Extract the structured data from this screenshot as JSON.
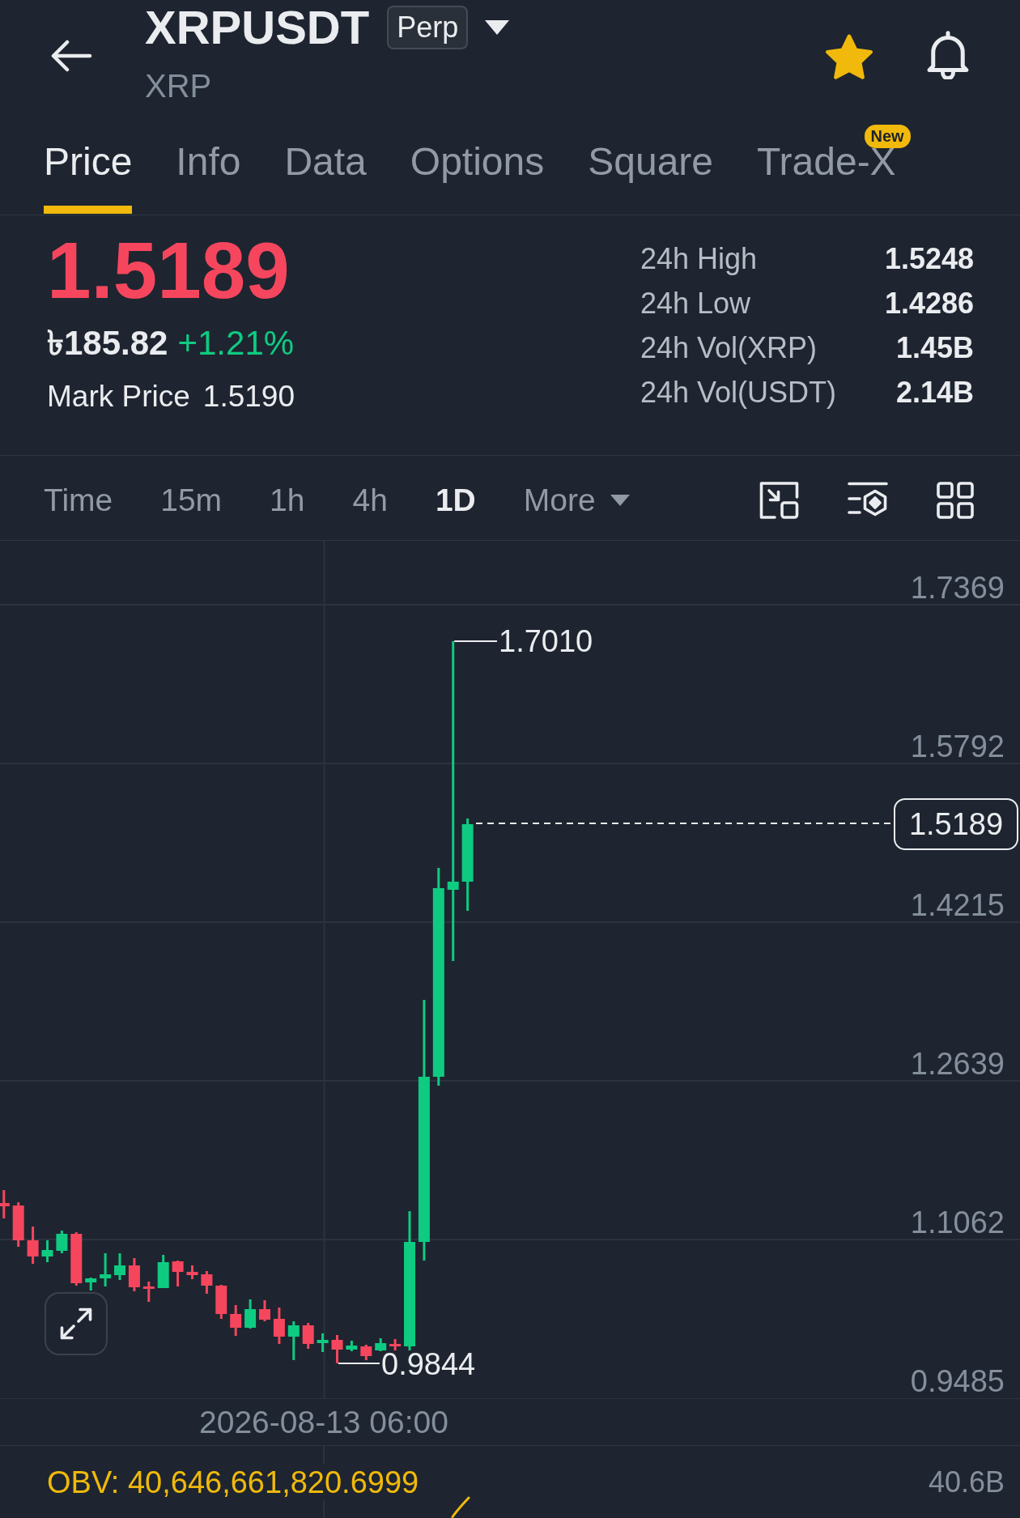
{
  "header": {
    "symbol": "XRPUSDT",
    "contract_badge": "Perp",
    "base_asset": "XRP",
    "favorited": true
  },
  "tabs": [
    {
      "label": "Price",
      "selected": true
    },
    {
      "label": "Info",
      "selected": false
    },
    {
      "label": "Data",
      "selected": false
    },
    {
      "label": "Options",
      "selected": false
    },
    {
      "label": "Square",
      "selected": false
    },
    {
      "label": "Trade-X",
      "selected": false,
      "badge": "New"
    }
  ],
  "ticker": {
    "last_price": "1.5189",
    "last_price_falling": true,
    "fiat_price": "৳185.82",
    "change": "+1.21%",
    "change_positive": true,
    "mark_price_label": "Mark Price",
    "mark_price": "1.5190"
  },
  "stats": [
    {
      "label": "24h High",
      "value": "1.5248"
    },
    {
      "label": "24h Low",
      "value": "1.4286"
    },
    {
      "label": "24h Vol(XRP)",
      "value": "1.45B"
    },
    {
      "label": "24h Vol(USDT)",
      "value": "2.14B"
    }
  ],
  "intervals": [
    {
      "label": "Time",
      "kind": "option",
      "selected": false
    },
    {
      "label": "15m",
      "kind": "option",
      "selected": false
    },
    {
      "label": "1h",
      "kind": "option",
      "selected": false
    },
    {
      "label": "4h",
      "kind": "option",
      "selected": false
    },
    {
      "label": "1D",
      "kind": "option",
      "selected": true
    },
    {
      "label": "More",
      "kind": "menu",
      "selected": false
    }
  ],
  "chart": {
    "price_axis_labels": [
      "1.7369",
      "1.5792",
      "1.4215",
      "1.2639",
      "1.1062",
      "0.9485"
    ],
    "high_label": "1.7010",
    "low_label": "0.9844",
    "last_price_tag": "1.5189",
    "time_label": "2026-08-13 06:00"
  },
  "indicator": {
    "label": "OBV: 40,646,661,820.6999",
    "axis_label": "40.6B"
  }
}
